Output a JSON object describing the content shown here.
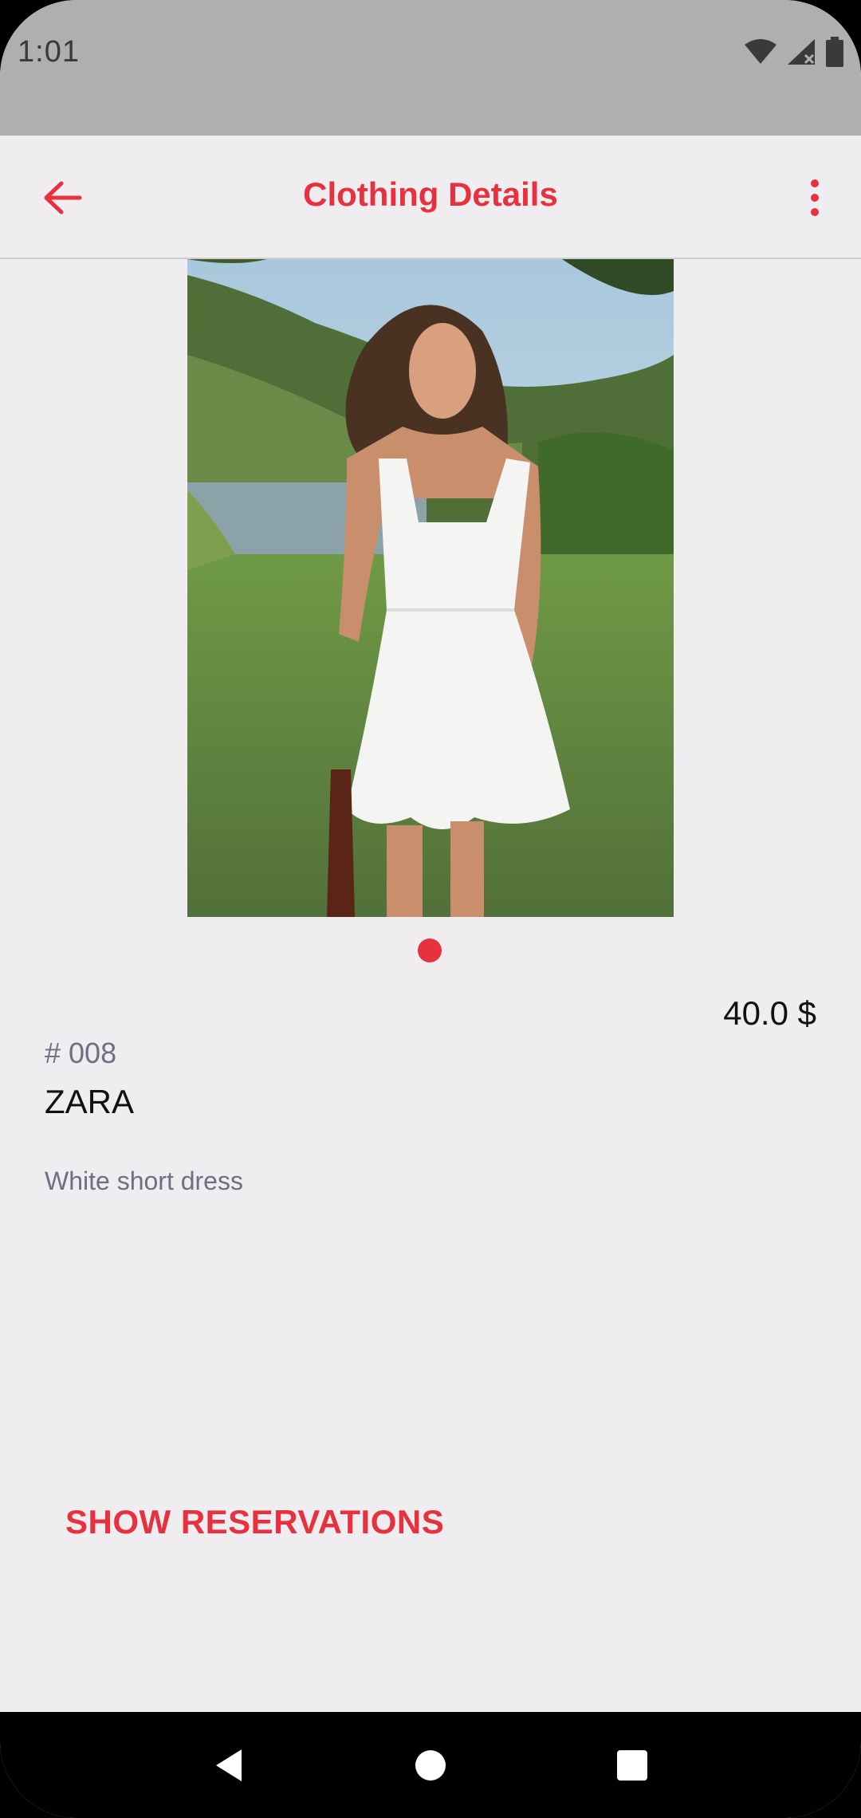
{
  "status_bar": {
    "time": "1:01",
    "icons": [
      "wifi-icon",
      "signal-icon",
      "battery-icon"
    ]
  },
  "app_bar": {
    "title": "Clothing Details",
    "back_icon": "arrow-left-icon",
    "menu_icon": "more-vert-icon"
  },
  "product": {
    "image": "dress-photo",
    "price": "40.0 $",
    "number": "# 008",
    "brand": "ZARA",
    "description": "White short dress"
  },
  "actions": {
    "show_reservations": "SHOW RESERVATIONS"
  },
  "nav_bar": {
    "icons": [
      "back-triangle-icon",
      "home-circle-icon",
      "recents-square-icon"
    ]
  },
  "colors": {
    "accent": "#e8313e",
    "background": "#efedef",
    "status_bar": "#b0aeb1"
  }
}
